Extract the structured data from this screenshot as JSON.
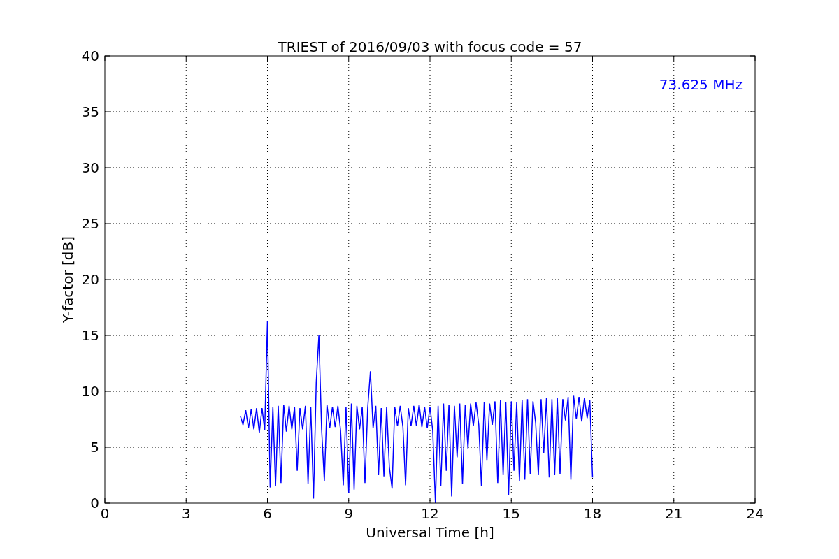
{
  "figure": {
    "chart_data": {
      "type": "line",
      "title": "TRIEST of 2016/09/03 with focus code = 57",
      "xlabel": "Universal Time [h]",
      "ylabel": "Y-factor [dB]",
      "xlim": [
        0,
        24
      ],
      "ylim": [
        0,
        40
      ],
      "xticks": [
        0,
        3,
        6,
        9,
        12,
        15,
        18,
        21,
        24
      ],
      "yticks": [
        0,
        5,
        10,
        15,
        20,
        25,
        30,
        35,
        40
      ],
      "x": [
        5.0,
        5.1,
        5.2,
        5.3,
        5.4,
        5.5,
        5.6,
        5.7,
        5.8,
        5.9,
        6.0,
        6.1,
        6.2,
        6.3,
        6.4,
        6.5,
        6.6,
        6.7,
        6.8,
        6.9,
        7.0,
        7.1,
        7.2,
        7.3,
        7.4,
        7.5,
        7.6,
        7.7,
        7.8,
        7.9,
        8.0,
        8.1,
        8.2,
        8.3,
        8.4,
        8.5,
        8.6,
        8.7,
        8.8,
        8.9,
        9.0,
        9.1,
        9.2,
        9.3,
        9.4,
        9.5,
        9.6,
        9.7,
        9.8,
        9.9,
        10.0,
        10.1,
        10.2,
        10.3,
        10.4,
        10.5,
        10.6,
        10.7,
        10.8,
        10.9,
        11.0,
        11.1,
        11.2,
        11.3,
        11.4,
        11.5,
        11.6,
        11.7,
        11.8,
        11.9,
        12.0,
        12.1,
        12.2,
        12.3,
        12.4,
        12.5,
        12.6,
        12.7,
        12.8,
        12.9,
        13.0,
        13.1,
        13.2,
        13.3,
        13.4,
        13.5,
        13.6,
        13.7,
        13.8,
        13.9,
        14.0,
        14.1,
        14.2,
        14.3,
        14.4,
        14.5,
        14.6,
        14.7,
        14.8,
        14.9,
        15.0,
        15.1,
        15.2,
        15.3,
        15.4,
        15.5,
        15.6,
        15.7,
        15.8,
        15.9,
        16.0,
        16.1,
        16.2,
        16.3,
        16.4,
        16.5,
        16.6,
        16.7,
        16.8,
        16.9,
        17.0,
        17.1,
        17.2,
        17.3,
        17.4,
        17.5,
        17.6,
        17.7,
        17.8,
        17.9,
        18.0
      ],
      "series": [
        {
          "color": "#0000ff",
          "values": [
            7.8,
            7.0,
            8.3,
            6.7,
            8.4,
            6.6,
            8.5,
            6.3,
            8.5,
            6.5,
            16.3,
            1.4,
            8.6,
            1.5,
            8.7,
            1.8,
            8.8,
            6.4,
            8.7,
            6.6,
            8.6,
            2.9,
            8.5,
            6.6,
            8.7,
            1.7,
            8.6,
            0.4,
            10.8,
            15.0,
            6.6,
            2.0,
            8.8,
            6.7,
            8.6,
            6.8,
            8.7,
            6.5,
            1.6,
            8.6,
            0.9,
            8.9,
            1.2,
            8.7,
            6.6,
            8.6,
            1.8,
            8.5,
            11.8,
            6.7,
            8.7,
            2.5,
            8.5,
            2.4,
            8.6,
            3.2,
            1.3,
            8.6,
            6.9,
            8.7,
            6.8,
            1.6,
            8.5,
            6.9,
            8.7,
            6.9,
            8.8,
            6.8,
            8.6,
            6.7,
            8.6,
            6.5,
            0.0,
            8.7,
            1.5,
            8.9,
            2.9,
            8.8,
            0.6,
            8.7,
            4.1,
            8.9,
            1.7,
            8.8,
            4.9,
            8.9,
            6.9,
            9.0,
            7.0,
            1.5,
            9.0,
            3.8,
            8.9,
            7.0,
            9.1,
            1.8,
            9.2,
            2.5,
            9.0,
            0.7,
            9.1,
            2.9,
            9.0,
            2.0,
            9.2,
            2.1,
            9.3,
            2.6,
            9.1,
            7.2,
            2.5,
            9.3,
            4.5,
            9.4,
            2.3,
            9.3,
            2.5,
            9.4,
            2.6,
            9.3,
            7.4,
            9.5,
            2.1,
            9.6,
            7.5,
            9.5,
            7.3,
            9.4,
            7.6,
            9.2,
            2.3
          ]
        }
      ],
      "grid": true,
      "annotations": [
        "73.625 MHz"
      ]
    }
  }
}
